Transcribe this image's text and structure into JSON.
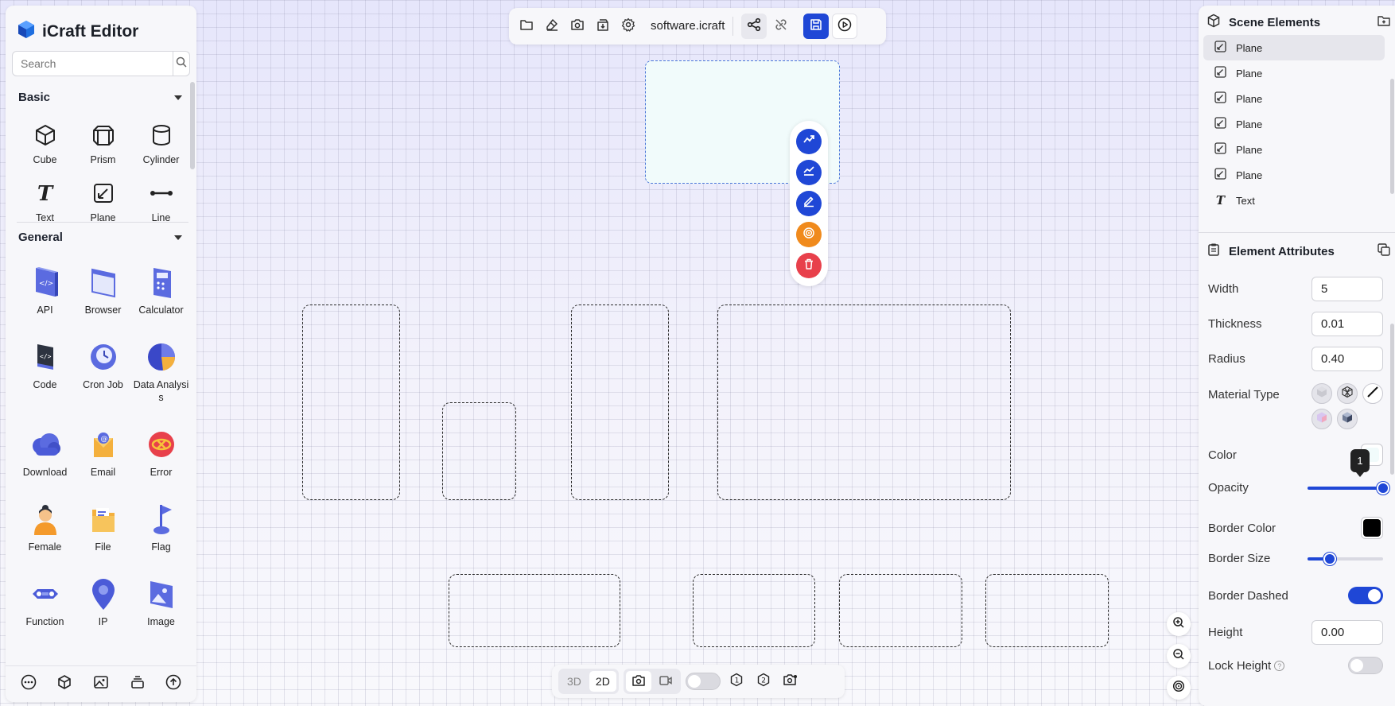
{
  "app": {
    "title": "iCraft Editor"
  },
  "search": {
    "placeholder": "Search"
  },
  "sections": {
    "basic": {
      "label": "Basic"
    },
    "general": {
      "label": "General"
    }
  },
  "basic_items": [
    {
      "label": "Cube",
      "icon": "cube-icon"
    },
    {
      "label": "Prism",
      "icon": "prism-icon"
    },
    {
      "label": "Cylinder",
      "icon": "cylinder-icon"
    },
    {
      "label": "Text",
      "icon": "text-icon"
    },
    {
      "label": "Plane",
      "icon": "plane-icon"
    },
    {
      "label": "Line",
      "icon": "line-icon"
    }
  ],
  "general_items": [
    {
      "label": "API",
      "icon": "api-icon"
    },
    {
      "label": "Browser",
      "icon": "browser-icon"
    },
    {
      "label": "Calculator",
      "icon": "calculator-icon"
    },
    {
      "label": "Code",
      "icon": "code-icon"
    },
    {
      "label": "Cron Job",
      "icon": "cron-job-icon"
    },
    {
      "label": "Data Analysis",
      "icon": "data-analysis-icon"
    },
    {
      "label": "Download",
      "icon": "download-icon"
    },
    {
      "label": "Email",
      "icon": "email-icon"
    },
    {
      "label": "Error",
      "icon": "error-icon"
    },
    {
      "label": "Female",
      "icon": "female-icon"
    },
    {
      "label": "File",
      "icon": "file-icon"
    },
    {
      "label": "Flag",
      "icon": "flag-icon"
    },
    {
      "label": "Function",
      "icon": "function-icon"
    },
    {
      "label": "IP",
      "icon": "ip-icon"
    },
    {
      "label": "Image",
      "icon": "image-icon"
    }
  ],
  "toolbar": {
    "filename": "software.icraft"
  },
  "bottombar": {
    "mode_3d": "3D",
    "mode_2d": "2D",
    "active_mode": "2D"
  },
  "scene": {
    "title": "Scene Elements",
    "elements": [
      {
        "label": "Plane",
        "type": "plane"
      },
      {
        "label": "Plane",
        "type": "plane"
      },
      {
        "label": "Plane",
        "type": "plane"
      },
      {
        "label": "Plane",
        "type": "plane"
      },
      {
        "label": "Plane",
        "type": "plane"
      },
      {
        "label": "Plane",
        "type": "plane"
      },
      {
        "label": "Text",
        "type": "text"
      }
    ]
  },
  "attributes": {
    "title": "Element Attributes",
    "width": {
      "label": "Width",
      "value": "5"
    },
    "thickness": {
      "label": "Thickness",
      "value": "0.01"
    },
    "radius": {
      "label": "Radius",
      "value": "0.40"
    },
    "material_type": {
      "label": "Material Type"
    },
    "color": {
      "label": "Color"
    },
    "opacity": {
      "label": "Opacity",
      "value": 1,
      "tooltip": "1"
    },
    "border_color": {
      "label": "Border Color",
      "value": "#000000"
    },
    "border_size": {
      "label": "Border Size",
      "level": 0.3
    },
    "border_dashed": {
      "label": "Border Dashed",
      "on": true
    },
    "height": {
      "label": "Height",
      "value": "0.00"
    },
    "lock_height": {
      "label": "Lock Height",
      "help": "?",
      "on": false
    }
  },
  "colors": {
    "accent": "#1f47d6",
    "orange": "#f08a1c",
    "red": "#e8404b"
  }
}
